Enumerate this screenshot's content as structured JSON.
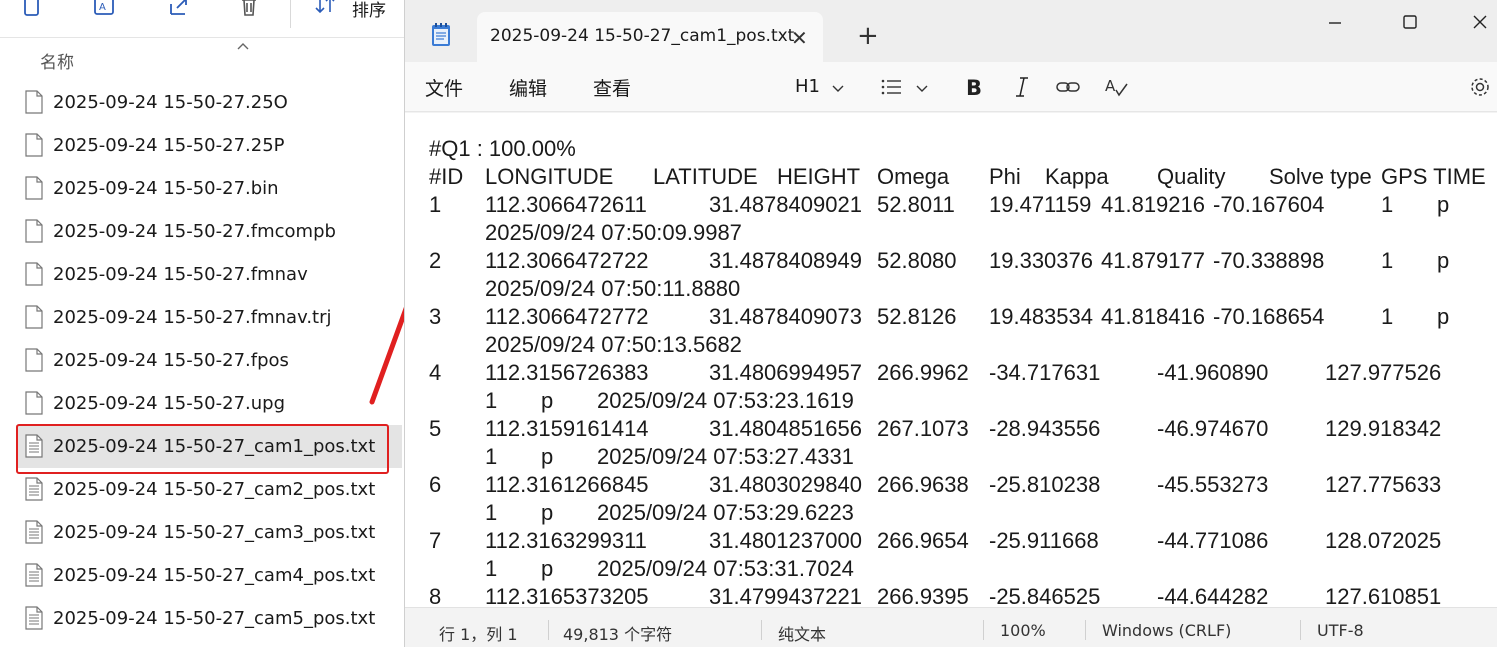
{
  "explorer": {
    "sort_label": "排序",
    "column_name": "名称",
    "files": [
      {
        "name": "2025-09-24 15-50-27.25O",
        "icon": "blank-file-icon"
      },
      {
        "name": "2025-09-24 15-50-27.25P",
        "icon": "blank-file-icon"
      },
      {
        "name": "2025-09-24 15-50-27.bin",
        "icon": "blank-file-icon"
      },
      {
        "name": "2025-09-24 15-50-27.fmcompb",
        "icon": "blank-file-icon"
      },
      {
        "name": "2025-09-24 15-50-27.fmnav",
        "icon": "blank-file-icon"
      },
      {
        "name": "2025-09-24 15-50-27.fmnav.trj",
        "icon": "blank-file-icon"
      },
      {
        "name": "2025-09-24 15-50-27.fpos",
        "icon": "blank-file-icon"
      },
      {
        "name": "2025-09-24 15-50-27.upg",
        "icon": "blank-file-icon"
      },
      {
        "name": "2025-09-24 15-50-27_cam1_pos.txt",
        "icon": "text-file-icon",
        "selected": true
      },
      {
        "name": "2025-09-24 15-50-27_cam2_pos.txt",
        "icon": "text-file-icon"
      },
      {
        "name": "2025-09-24 15-50-27_cam3_pos.txt",
        "icon": "text-file-icon"
      },
      {
        "name": "2025-09-24 15-50-27_cam4_pos.txt",
        "icon": "text-file-icon"
      },
      {
        "name": "2025-09-24 15-50-27_cam5_pos.txt",
        "icon": "text-file-icon"
      }
    ],
    "annotation_color": "#e02020"
  },
  "notepad": {
    "tab_title": "2025-09-24 15-50-27_cam1_pos.txt",
    "new_tab": "+",
    "menu": {
      "file": "文件",
      "edit": "编辑",
      "view": "查看"
    },
    "heading_select": "H1",
    "content": {
      "quality_line": "#Q1 : 100.00%",
      "headers": [
        "#ID",
        "LONGITUDE",
        "LATITUDE",
        "HEIGHT",
        "Omega",
        "Phi",
        "Kappa",
        "Quality",
        "Solve type",
        "GPS TIME"
      ],
      "rows_a": [
        {
          "id": "1",
          "lon": "112.3066472611",
          "lat": "31.4878409021",
          "h": "52.8011",
          "omega": "19.471159",
          "phi": "41.819216",
          "kappa": "-70.167604",
          "quality": "1",
          "solve": "p",
          "time": "2025/09/24 07:50:09.9987"
        },
        {
          "id": "2",
          "lon": "112.3066472722",
          "lat": "31.4878408949",
          "h": "52.8080",
          "omega": "19.330376",
          "phi": "41.879177",
          "kappa": "-70.338898",
          "quality": "1",
          "solve": "p",
          "time": "2025/09/24 07:50:11.8880"
        },
        {
          "id": "3",
          "lon": "112.3066472772",
          "lat": "31.4878409073",
          "h": "52.8126",
          "omega": "19.483534",
          "phi": "41.818416",
          "kappa": "-70.168654",
          "quality": "1",
          "solve": "p",
          "time": "2025/09/24 07:50:13.5682"
        }
      ],
      "rows_b": [
        {
          "id": "4",
          "lon": "112.3156726383",
          "lat": "31.4806994957",
          "h": "266.9962",
          "omega": "-34.717631",
          "phi": "-41.960890",
          "kappa": "127.977526",
          "quality": "1",
          "solve": "p",
          "time": "2025/09/24 07:53:23.1619"
        },
        {
          "id": "5",
          "lon": "112.3159161414",
          "lat": "31.4804851656",
          "h": "267.1073",
          "omega": "-28.943556",
          "phi": "-46.974670",
          "kappa": "129.918342",
          "quality": "1",
          "solve": "p",
          "time": "2025/09/24 07:53:27.4331"
        },
        {
          "id": "6",
          "lon": "112.3161266845",
          "lat": "31.4803029840",
          "h": "266.9638",
          "omega": "-25.810238",
          "phi": "-45.553273",
          "kappa": "127.775633",
          "quality": "1",
          "solve": "p",
          "time": "2025/09/24 07:53:29.6223"
        },
        {
          "id": "7",
          "lon": "112.3163299311",
          "lat": "31.4801237000",
          "h": "266.9654",
          "omega": "-25.911668",
          "phi": "-44.771086",
          "kappa": "128.072025",
          "quality": "1",
          "solve": "p",
          "time": "2025/09/24 07:53:31.7024"
        },
        {
          "id": "8",
          "lon": "112.3165373205",
          "lat": "31.4799437221",
          "h": "266.9395",
          "omega": "-25.846525",
          "phi": "-44.644282",
          "kappa": "127.610851"
        }
      ]
    },
    "status": {
      "position": "行 1，列 1",
      "char_count": "49,813 个字符",
      "format": "纯文本",
      "zoom": "100%",
      "line_ending": "Windows (CRLF)",
      "encoding": "UTF-8"
    }
  }
}
